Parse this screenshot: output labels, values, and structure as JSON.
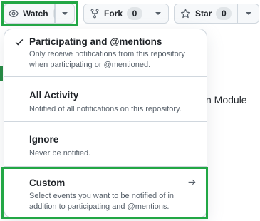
{
  "toolbar": {
    "watch_label": "Watch",
    "watch_count": "0",
    "fork_label": "Fork",
    "fork_count": "0",
    "star_label": "Star",
    "star_count": "0"
  },
  "background": {
    "partial_text": "n Module"
  },
  "menu": {
    "items": [
      {
        "title": "Participating and @mentions",
        "description": "Only receive notifications from this repository when participating or @mentioned.",
        "selected": true
      },
      {
        "title": "All Activity",
        "description": "Notified of all notifications on this repository.",
        "selected": false
      },
      {
        "title": "Ignore",
        "description": "Never be notified.",
        "selected": false
      },
      {
        "title": "Custom",
        "description": "Select events you want to be notified of in addition to participating and @mentions.",
        "selected": false,
        "has_submenu": true
      }
    ]
  },
  "colors": {
    "highlight": "#22a745",
    "accent": "#1f883d"
  }
}
